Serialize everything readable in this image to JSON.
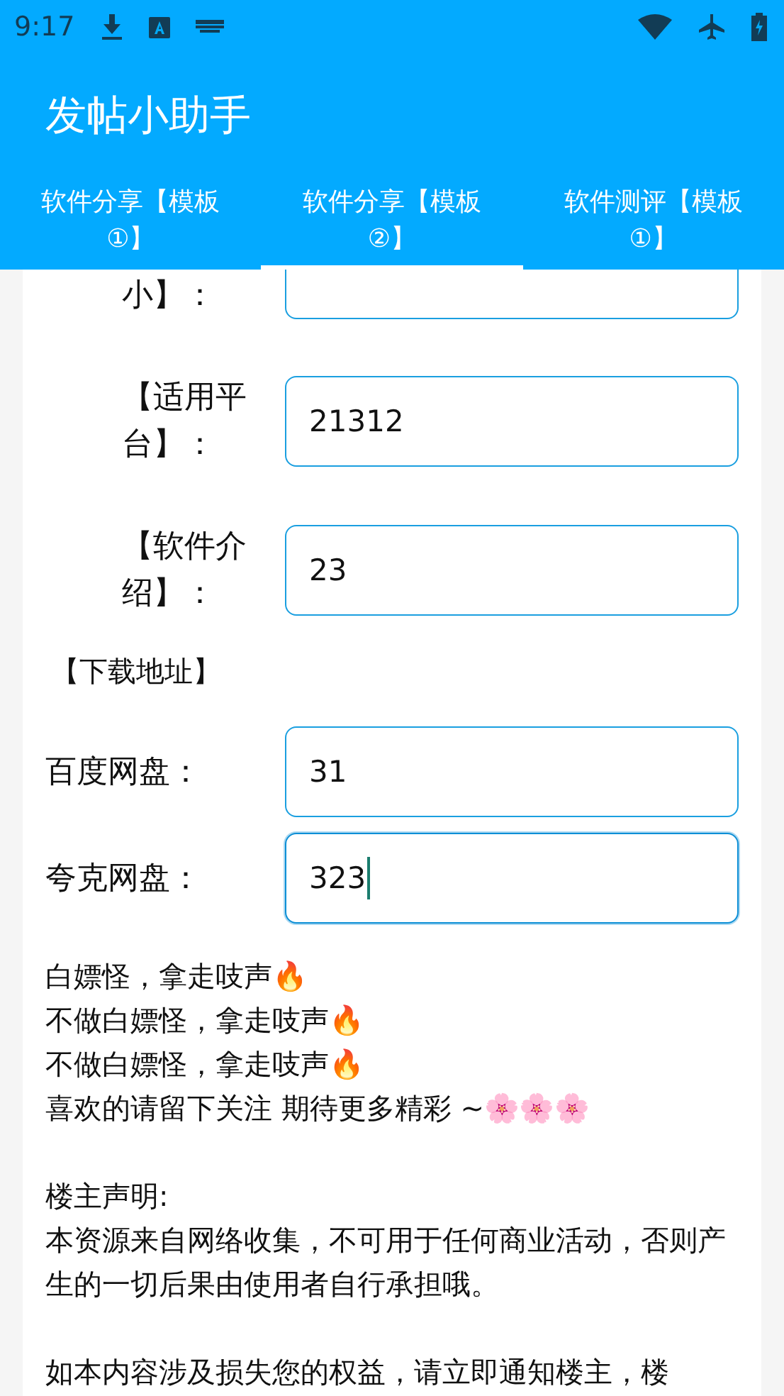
{
  "status_bar": {
    "time": "9:17"
  },
  "app_bar": {
    "title": "发帖小助手"
  },
  "tabs": [
    {
      "label": "软件分享【模板①】",
      "selected": false
    },
    {
      "label": "软件分享【模板②】",
      "selected": true
    },
    {
      "label": "软件测评【模板①】",
      "selected": false
    }
  ],
  "form": [
    {
      "kind": "cut",
      "label": "小】：",
      "focused": false
    },
    {
      "kind": "field",
      "label": "【适用平台】：",
      "value": "21312",
      "focused": false
    },
    {
      "kind": "field",
      "label": "【软件介绍】：",
      "value": "23",
      "focused": false
    },
    {
      "kind": "heading",
      "label": "【下载地址】"
    },
    {
      "kind": "wide",
      "label": "百度网盘：",
      "value": "31",
      "focused": false
    },
    {
      "kind": "wide",
      "label": "夸克网盘：",
      "value": "323",
      "focused": true
    }
  ],
  "body": [
    [
      {
        "text": "白嫖怪，拿走吱声🔥"
      },
      {
        "text": "不做白嫖怪，拿走吱声🔥"
      },
      {
        "text": "不做白嫖怪，拿走吱声🔥"
      },
      {
        "text": "喜欢的请留下关注 期待更多精彩 ~🌸🌸🌸"
      }
    ],
    [
      {
        "text": "楼主声明:"
      },
      {
        "text": "本资源来自网络收集，不可用于任何商业活动，否则产生的一切后果由使用者自行承担哦。"
      }
    ],
    [
      {
        "text": "如本内容涉及损失您的权益，请立即通知楼主，楼"
      }
    ]
  ]
}
